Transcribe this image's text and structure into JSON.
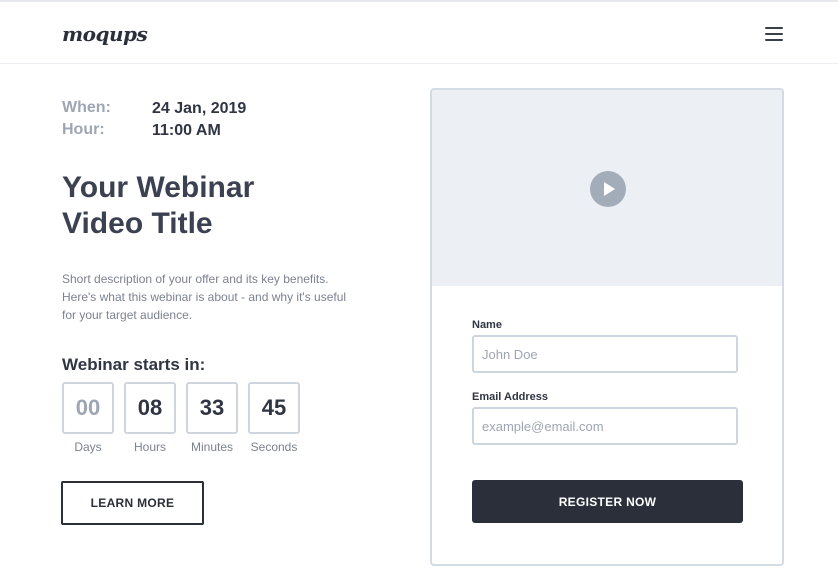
{
  "header": {
    "logo": "moqups",
    "menu_icon": "hamburger-menu-icon"
  },
  "event": {
    "when_label": "When:",
    "when_value": "24 Jan, 2019",
    "hour_label": "Hour:",
    "hour_value": "11:00 AM"
  },
  "content": {
    "title_line1": "Your Webinar",
    "title_line2": "Video Title",
    "description": "Short description of your offer and its key benefits. Here's what this webinar is about - and why it's useful for your target audience."
  },
  "countdown": {
    "label": "Webinar starts in:",
    "units": [
      {
        "value": "00",
        "label": "Days"
      },
      {
        "value": "08",
        "label": "Hours"
      },
      {
        "value": "33",
        "label": "Minutes"
      },
      {
        "value": "45",
        "label": "Seconds"
      }
    ]
  },
  "actions": {
    "learn_more": "LEARN MORE",
    "register_now": "REGISTER NOW"
  },
  "video": {
    "play_icon": "play-icon"
  },
  "form": {
    "name_label": "Name",
    "name_placeholder": "John Doe",
    "name_value": "",
    "email_label": "Email Address",
    "email_placeholder": "example@email.com",
    "email_value": ""
  },
  "colors": {
    "primary_dark": "#2a2f3a",
    "muted_label": "#9ea6b3",
    "border": "#cfd5de",
    "video_bg": "#eceff3"
  }
}
